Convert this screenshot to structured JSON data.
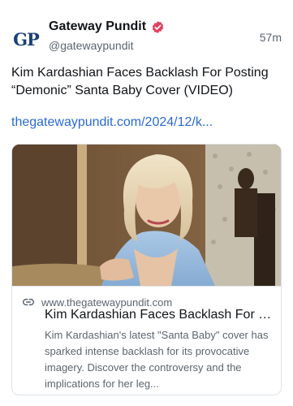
{
  "author": {
    "avatar_text": "GP",
    "display_name": "Gateway Pundit",
    "handle": "@gatewaypundit",
    "verified": true,
    "verified_color": "#e0405f"
  },
  "post": {
    "time": "57m",
    "text": "Kim Kardashian Faces Backlash For Posting “Demonic” Santa Baby Cover (VIDEO)",
    "link_text": "thegatewaypundit.com/2024/12/k...",
    "link_color": "#2a6ad1"
  },
  "card": {
    "image_icon": "video-still-image",
    "domain": "www.thegatewaypundit.com",
    "title": "Kim Kardashian Faces Backlash For P...",
    "description": "Kim Kardashian's latest \"Santa Baby\" cover has sparked intense backlash for its provocative imagery. Discover the controversy and the implications for her leg..."
  },
  "icons": {
    "verified": "verified-badge-icon",
    "link": "link-icon"
  }
}
